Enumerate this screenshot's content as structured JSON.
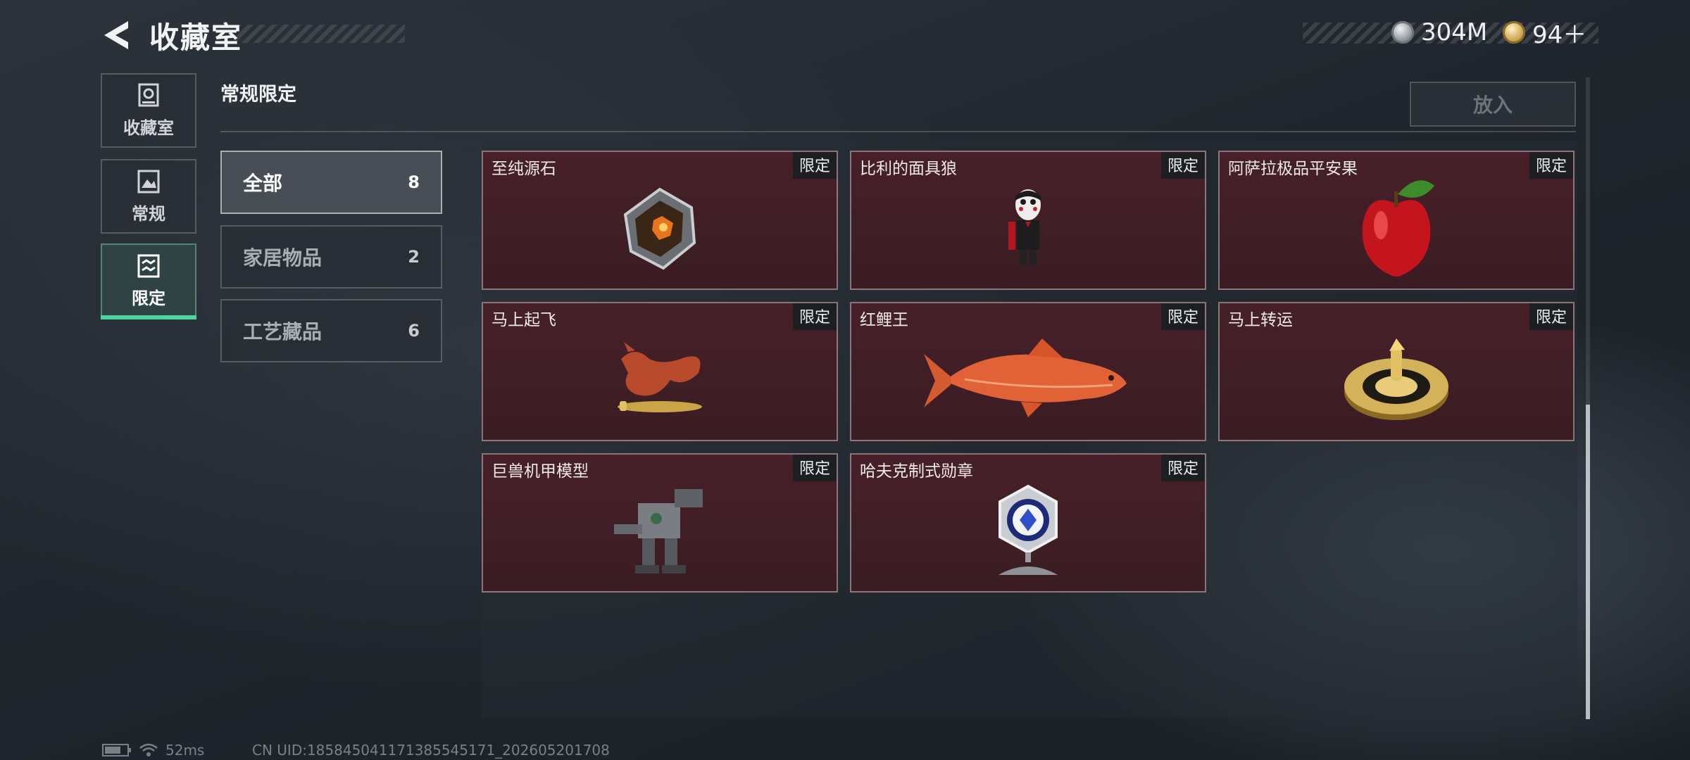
{
  "header": {
    "title": "收藏室",
    "currency": [
      {
        "icon": "silver-coin-icon",
        "value": "304M"
      },
      {
        "icon": "gold-coin-icon",
        "value": "94＋"
      }
    ]
  },
  "nav": {
    "items": [
      {
        "label": "收藏室",
        "icon": "trophy-case-icon",
        "active": false
      },
      {
        "label": "常规",
        "icon": "gallery-icon",
        "active": false
      },
      {
        "label": "限定",
        "icon": "limited-icon",
        "active": true
      }
    ]
  },
  "section": {
    "title": "常规限定",
    "put_button": "放入"
  },
  "filters": [
    {
      "label": "全部",
      "count": "8",
      "active": true
    },
    {
      "label": "家居物品",
      "count": "2",
      "active": false
    },
    {
      "label": "工艺藏品",
      "count": "6",
      "active": false
    }
  ],
  "items": [
    {
      "name": "至纯源石",
      "badge": "限定",
      "icon": "gem-icon"
    },
    {
      "name": "比利的面具狼",
      "badge": "限定",
      "icon": "puppet-figure-icon"
    },
    {
      "name": "阿萨拉极品平安果",
      "badge": "限定",
      "icon": "apple-icon"
    },
    {
      "name": "马上起飞",
      "badge": "限定",
      "icon": "horse-sculpture-icon"
    },
    {
      "name": "红鲤王",
      "badge": "限定",
      "icon": "carp-icon"
    },
    {
      "name": "马上转运",
      "badge": "限定",
      "icon": "golden-disc-icon"
    },
    {
      "name": "巨兽机甲模型",
      "badge": "限定",
      "icon": "mech-model-icon"
    },
    {
      "name": "哈夫克制式勋章",
      "badge": "限定",
      "icon": "medal-icon"
    }
  ],
  "status_bar": {
    "ping": "52ms",
    "uid": "CN UID:1858450411713855451​71_202605201708"
  },
  "colors": {
    "accent": "#4fd3a0",
    "card_bg": "#3f1e26"
  }
}
